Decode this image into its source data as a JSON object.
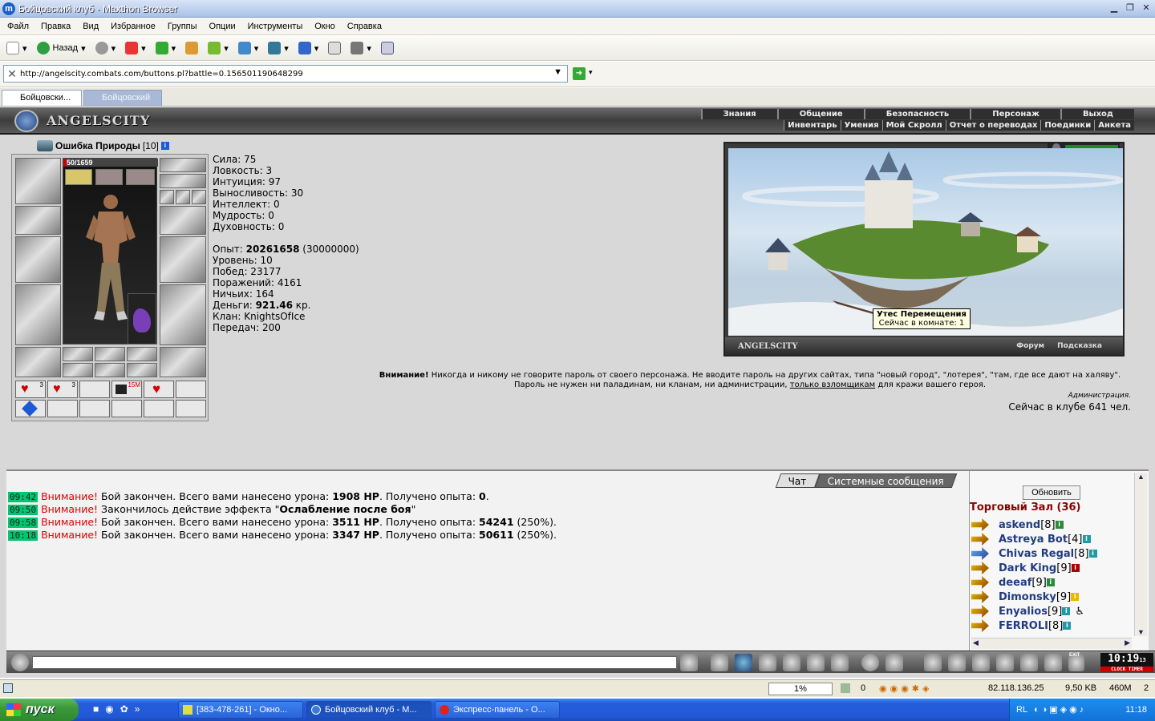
{
  "window": {
    "title": "Бойцовский клуб - Maxthon Browser"
  },
  "menu": [
    "Файл",
    "Правка",
    "Вид",
    "Избранное",
    "Группы",
    "Опции",
    "Инструменты",
    "Окно",
    "Справка"
  ],
  "toolbar": {
    "back_label": "Назад"
  },
  "address": {
    "url": "http://angelscity.combats.com/buttons.pl?battle=0.156501190648299"
  },
  "tabs": [
    {
      "label": "Бойцовски..."
    },
    {
      "label": "Бойцовский ..."
    }
  ],
  "game": {
    "logo": "ANGELSCITY",
    "nav_top": [
      "Знания",
      "Общение",
      "Безопасность",
      "Персонаж",
      "Выход"
    ],
    "nav_bottom": [
      "Инвентарь",
      "Умения",
      "Мой Скролл",
      "Отчет о переводах",
      "Поединки",
      "Анкета"
    ],
    "character": {
      "name": "Ошибка Природы",
      "level": "[10]",
      "hp": "50/1659",
      "hp_fraction": 0.03,
      "stats": [
        "Сила: 75",
        "Ловкость: 3",
        "Интуиция: 97",
        "Выносливость: 30",
        "Интеллект: 0",
        "Мудрость: 0",
        "Духовность: 0"
      ],
      "experience_label": "Опыт:",
      "experience": "20261658",
      "experience_next": "(30000000)",
      "level_line": "Уровень: 10",
      "wins": "Побед: 23177",
      "losses": "Поражений: 4161",
      "draws": "Ничьих: 164",
      "money_label": "Деньги:",
      "money": "921.46",
      "money_unit": "кр.",
      "clan": "Клан: KnightsOfIce",
      "transfers": "Передач: 200",
      "potion_counts": [
        "3",
        "3"
      ],
      "scroll_label": "15M"
    },
    "map": {
      "location_name": "Утес Перемещения",
      "location_count": "Сейчас в комнате: 1",
      "city_label": "ANGELSCITY",
      "links": [
        "Форум",
        "Подсказка"
      ]
    },
    "warning": {
      "bold": "Внимание!",
      "text": " Никогда и никому не говорите пароль от своего персонажа. Не вводите пароль на других сайтах, типа \"новый город\", \"лотерея\", \"там, где все дают на халяву\". Пароль не нужен ни паладинам, ни кланам, ни администрации, ",
      "link": "только взломщикам",
      "text_end": " для кражи вашего героя.",
      "signature": "Администрация.",
      "online": "Сейчас в клубе 641 чел."
    },
    "chat": {
      "tabs": [
        "Чат",
        "Системные сообщения"
      ],
      "messages": [
        {
          "time": "09:42",
          "attn": "Внимание!",
          "pre": " Бой закончен. Всего вами нанесено урона: ",
          "b1": "1908 HP",
          "mid": ". Получено опыта: ",
          "b2": "0",
          "post": "."
        },
        {
          "time": "09:50",
          "attn": "Внимание!",
          "pre": " Закончилось действие эффекта \"",
          "b1": "Ослабление после боя",
          "mid": "\"",
          "b2": "",
          "post": ""
        },
        {
          "time": "09:58",
          "attn": "Внимание!",
          "pre": " Бой закончен. Всего вами нанесено урона: ",
          "b1": "3511 HP",
          "mid": ". Получено опыта: ",
          "b2": "54241",
          "post": " (250%)."
        },
        {
          "time": "10:18",
          "attn": "Внимание!",
          "pre": " Бой закончен. Всего вами нанесено урона: ",
          "b1": "3347 HP",
          "mid": ". Получено опыта: ",
          "b2": "50611",
          "post": " (250%)."
        }
      ]
    },
    "userlist": {
      "refresh_label": "Обновить",
      "room": "Торговый Зал (36)",
      "users": [
        {
          "name": "askend",
          "level": "[8]"
        },
        {
          "name": "Astreya Bot",
          "level": "[4]"
        },
        {
          "name": "Chivas Regal",
          "level": "[8]"
        },
        {
          "name": "Dark King",
          "level": "[9]"
        },
        {
          "name": "deeaf",
          "level": "[9]"
        },
        {
          "name": "Dimonsky",
          "level": "[9]"
        },
        {
          "name": "Enyalios",
          "level": "[9]"
        },
        {
          "name": "FERROLI",
          "level": "[8]"
        }
      ]
    },
    "clock": {
      "time": "10:19",
      "seconds": "13",
      "labels": "CLOCK TIMER",
      "exit": "EXIT"
    }
  },
  "status": {
    "zoom": "1%",
    "count": "0",
    "ip": "82.118.136.25",
    "speed": "9,50 KB",
    "memory": "460M",
    "num": "2"
  },
  "taskbar": {
    "start": "пуск",
    "items": [
      "[383-478-261] - Окно...",
      "Бойцовский клуб - M...",
      "Экспресс-панель - O..."
    ],
    "lang": "RL",
    "time": "11:18"
  }
}
